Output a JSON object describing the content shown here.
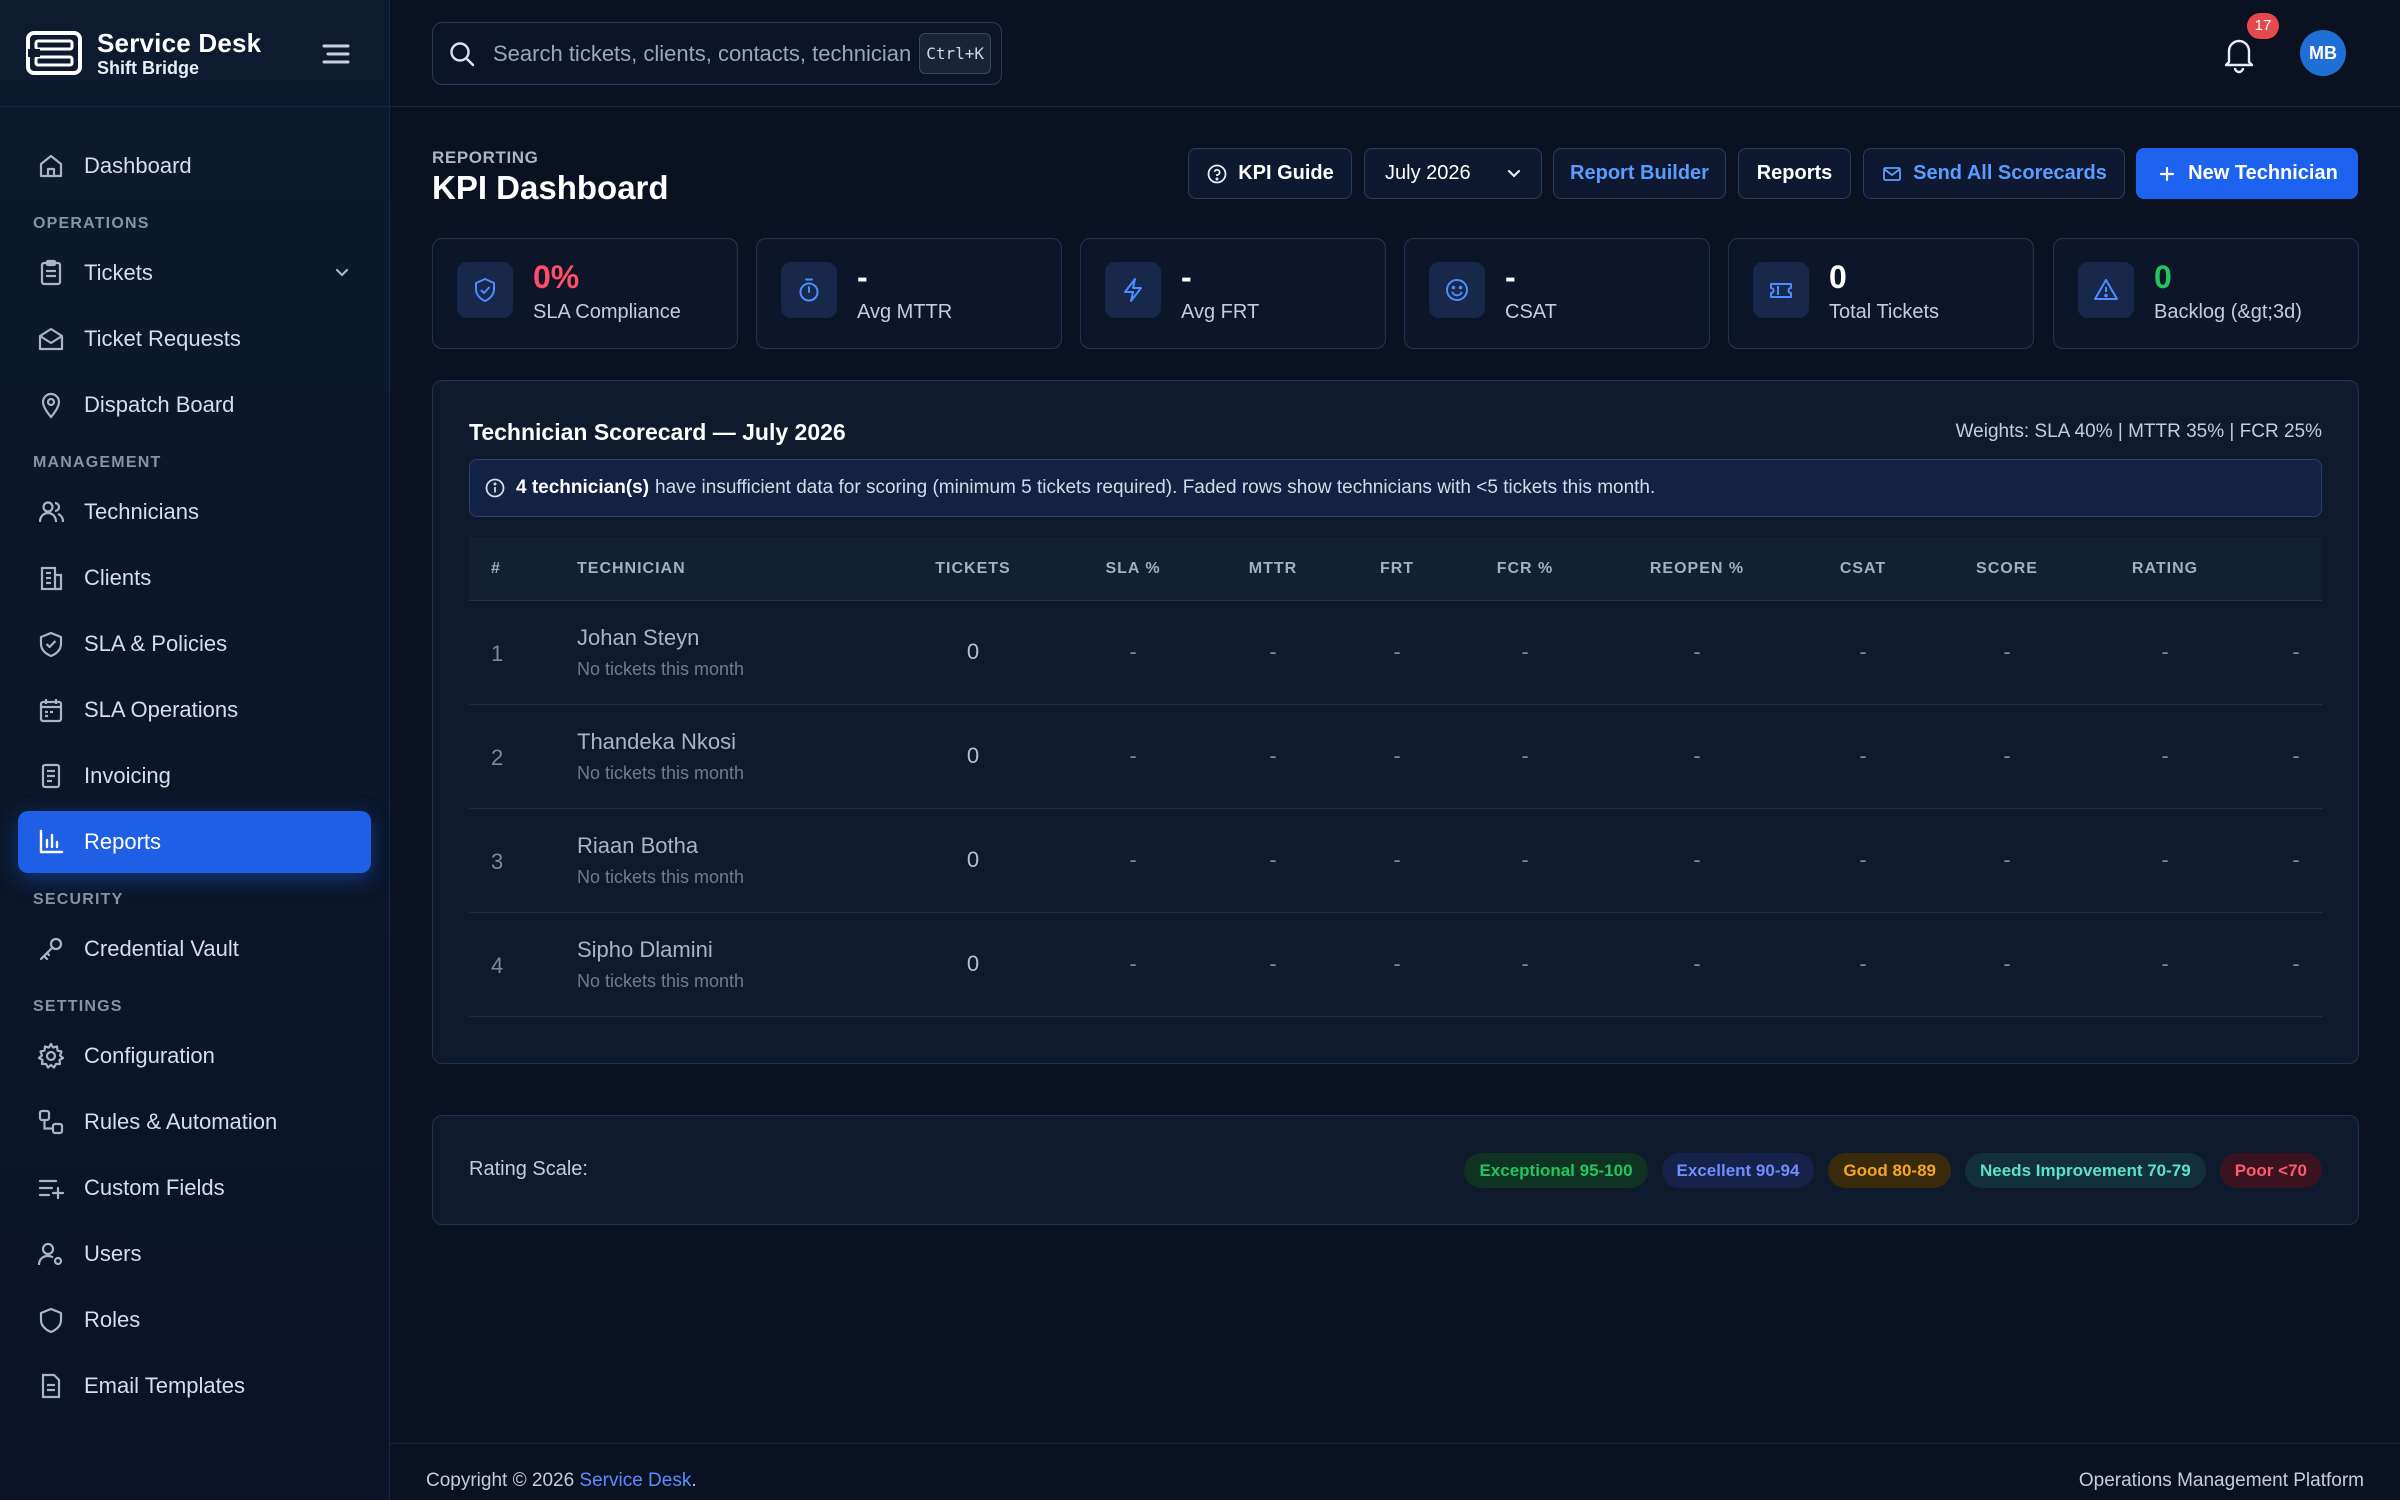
{
  "brand": {
    "title": "Service Desk",
    "subtitle": "Shift Bridge"
  },
  "search": {
    "placeholder": "Search tickets, clients, contacts, technician",
    "shortcut": "Ctrl+K"
  },
  "notifications": {
    "count": "17"
  },
  "user": {
    "initials": "MB"
  },
  "sidebar": {
    "dashboard": "Dashboard",
    "sections": {
      "operations": "OPERATIONS",
      "management": "MANAGEMENT",
      "security": "SECURITY",
      "settings": "SETTINGS"
    },
    "items": {
      "tickets": "Tickets",
      "ticket_requests": "Ticket Requests",
      "dispatch_board": "Dispatch Board",
      "technicians": "Technicians",
      "clients": "Clients",
      "sla_policies": "SLA & Policies",
      "sla_operations": "SLA Operations",
      "invoicing": "Invoicing",
      "reports": "Reports",
      "credential_vault": "Credential Vault",
      "configuration": "Configuration",
      "rules_automation": "Rules & Automation",
      "custom_fields": "Custom Fields",
      "users": "Users",
      "roles": "Roles",
      "email_templates": "Email Templates"
    },
    "active": "reports"
  },
  "header": {
    "eyebrow": "REPORTING",
    "title": "KPI Dashboard",
    "buttons": {
      "kpi_guide": "KPI Guide",
      "period": "July 2026",
      "report_builder": "Report Builder",
      "reports": "Reports",
      "send_scorecards": "Send All Scorecards",
      "new_technician": "New Technician"
    }
  },
  "kpis": [
    {
      "value": "0%",
      "label": "SLA Compliance",
      "icon": "shield-check-icon"
    },
    {
      "value": "-",
      "label": "Avg MTTR",
      "icon": "stopwatch-icon"
    },
    {
      "value": "-",
      "label": "Avg FRT",
      "icon": "bolt-icon"
    },
    {
      "value": "-",
      "label": "CSAT",
      "icon": "smiley-icon"
    },
    {
      "value": "0",
      "label": "Total Tickets",
      "icon": "ticket-icon"
    },
    {
      "value": "0",
      "label": "Backlog (&gt;3d)",
      "icon": "warning-icon"
    }
  ],
  "scorecard": {
    "title": "Technician Scorecard — July 2026",
    "weights": "Weights: SLA 40% | MTTR 35% | FCR 25%",
    "notice": {
      "bold": "4 technician(s)",
      "text": "have insufficient data for scoring (minimum 5 tickets required). Faded rows show technicians with <5 tickets this month."
    },
    "columns": [
      "#",
      "TECHNICIAN",
      "TICKETS",
      "SLA %",
      "MTTR",
      "FRT",
      "FCR %",
      "REOPEN %",
      "CSAT",
      "SCORE",
      "RATING"
    ],
    "rows": [
      {
        "rank": "1",
        "name": "Johan Steyn",
        "note": "No tickets this month",
        "tickets": "0",
        "sla": "-",
        "mttr": "-",
        "frt": "-",
        "fcr": "-",
        "reopen": "-",
        "csat": "-",
        "score": "-",
        "rating": "-",
        "extra": "-"
      },
      {
        "rank": "2",
        "name": "Thandeka Nkosi",
        "note": "No tickets this month",
        "tickets": "0",
        "sla": "-",
        "mttr": "-",
        "frt": "-",
        "fcr": "-",
        "reopen": "-",
        "csat": "-",
        "score": "-",
        "rating": "-",
        "extra": "-"
      },
      {
        "rank": "3",
        "name": "Riaan Botha",
        "note": "No tickets this month",
        "tickets": "0",
        "sla": "-",
        "mttr": "-",
        "frt": "-",
        "fcr": "-",
        "reopen": "-",
        "csat": "-",
        "score": "-",
        "rating": "-",
        "extra": "-"
      },
      {
        "rank": "4",
        "name": "Sipho Dlamini",
        "note": "No tickets this month",
        "tickets": "0",
        "sla": "-",
        "mttr": "-",
        "frt": "-",
        "fcr": "-",
        "reopen": "-",
        "csat": "-",
        "score": "-",
        "rating": "-",
        "extra": "-"
      }
    ]
  },
  "rating_scale": {
    "label": "Rating Scale:",
    "items": [
      "Exceptional 95-100",
      "Excellent 90-94",
      "Good 80-89",
      "Needs Improvement 70-79",
      "Poor <70"
    ]
  },
  "footer": {
    "copyright": "Copyright © 2026",
    "brand": "Service Desk",
    "period": ".",
    "tagline": "Operations Management Platform"
  },
  "colors": {
    "accent": "#1d63f0",
    "danger": "#ff4d6a",
    "success": "#22c55e",
    "background": "#0a1222"
  }
}
